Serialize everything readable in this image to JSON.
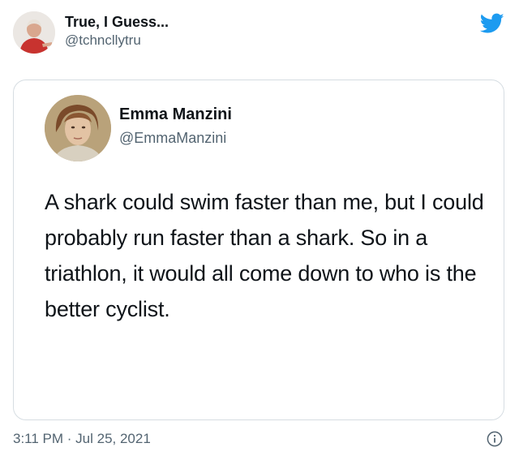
{
  "outer_tweet": {
    "display_name": "True, I Guess...",
    "handle": "@tchncllytru",
    "avatar_icon": "person-avatar"
  },
  "brand": {
    "logo_icon": "twitter-bird-icon",
    "logo_color": "#1d9bf0"
  },
  "quoted_tweet": {
    "display_name": "Emma Manzini",
    "handle": "@EmmaManzini",
    "avatar_icon": "portrait-avatar",
    "text": "A shark could swim faster than me, but I could probably run faster than a shark. So in a triathlon, it would all come down to who is the better cyclist."
  },
  "footer": {
    "timestamp": "3:11 PM · Jul 25, 2021",
    "info_icon": "info-icon"
  },
  "colors": {
    "primary_text": "#0f1419",
    "secondary_text": "#536471",
    "border": "#d6dde2"
  }
}
